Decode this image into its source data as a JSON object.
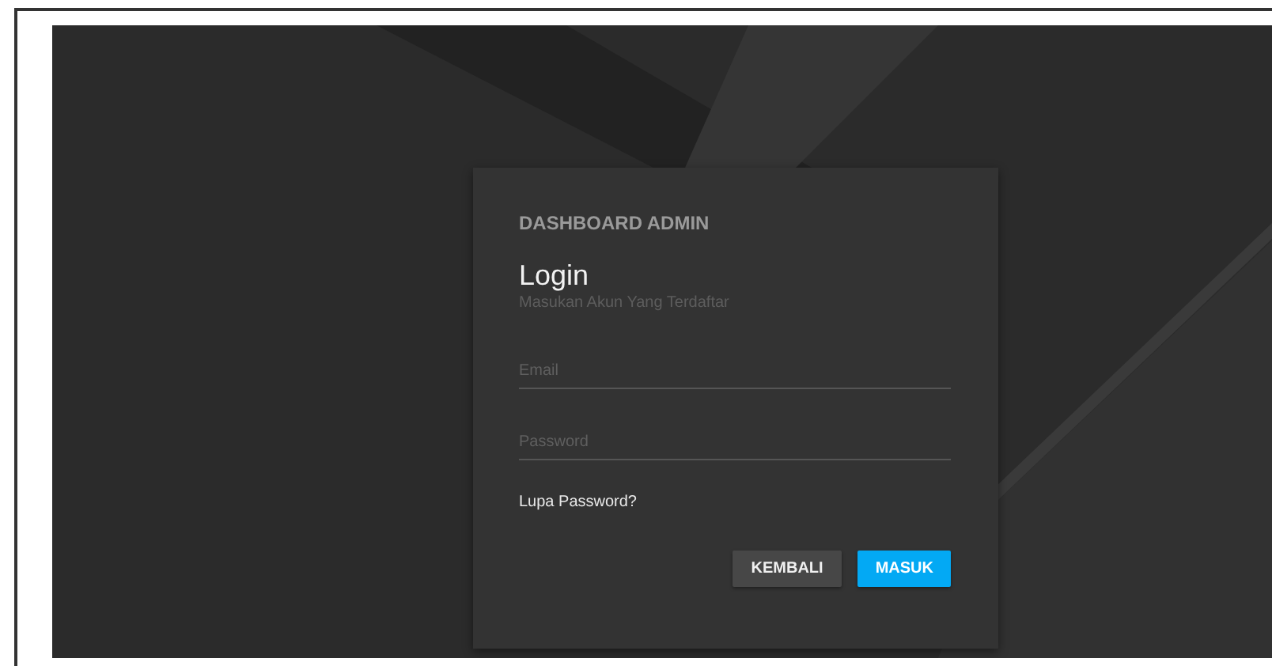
{
  "card": {
    "brand": "DASHBOARD ADMIN",
    "title": "Login",
    "subtitle": "Masukan Akun Yang Terdaftar"
  },
  "fields": [
    {
      "placeholder": "Email"
    },
    {
      "placeholder": "Password"
    }
  ],
  "link": "Lupa Password?",
  "buttons": [
    {
      "label": "KEMBALI",
      "kind": "secondary"
    },
    {
      "label": "MASUK",
      "kind": "primary"
    }
  ]
}
